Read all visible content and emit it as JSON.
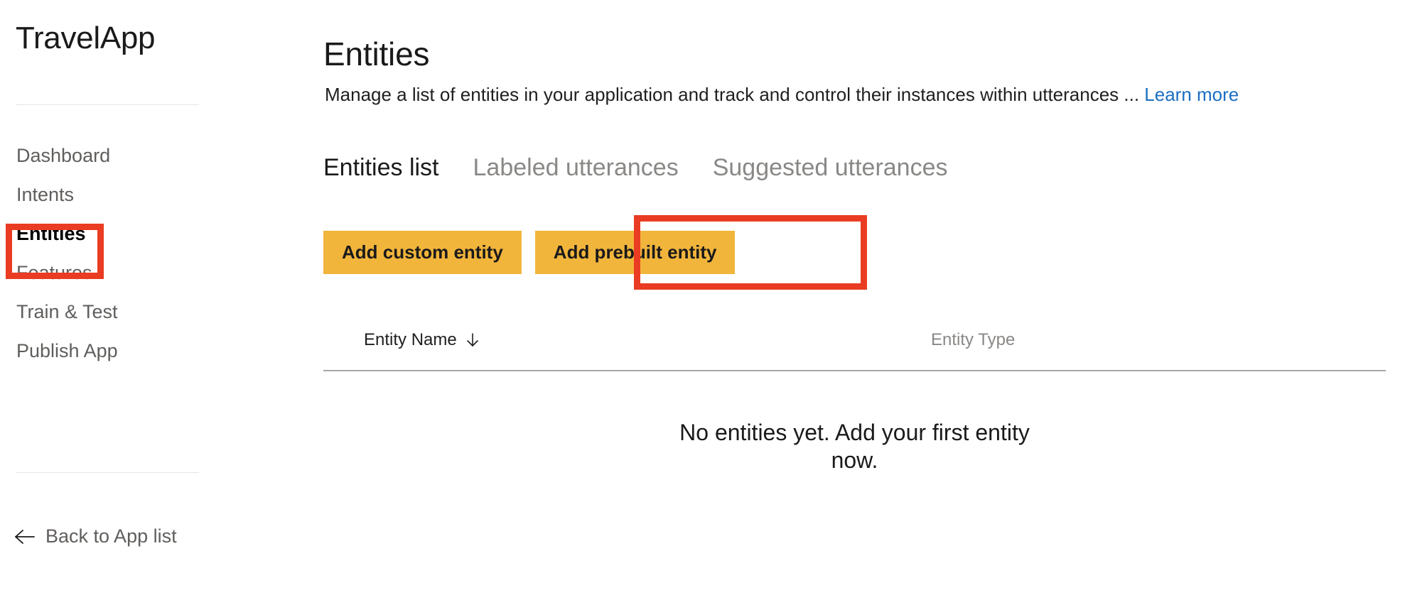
{
  "sidebar": {
    "app_title": "TravelApp",
    "items": [
      {
        "label": "Dashboard",
        "active": false
      },
      {
        "label": "Intents",
        "active": false
      },
      {
        "label": "Entities",
        "active": true
      },
      {
        "label": "Features",
        "active": false
      },
      {
        "label": "Train & Test",
        "active": false
      },
      {
        "label": "Publish App",
        "active": false
      }
    ],
    "back_link": {
      "label": "Back to App list",
      "icon": "arrow-left-icon"
    }
  },
  "main": {
    "page_title": "Entities",
    "subtitle": {
      "text": "Manage a list of entities in your application and track and control their instances within utterances ... ",
      "link_label": "Learn more"
    },
    "tabs": [
      {
        "label": "Entities list",
        "active": true
      },
      {
        "label": "Labeled utterances",
        "active": false
      },
      {
        "label": "Suggested utterances",
        "active": false
      }
    ],
    "actions": [
      {
        "label": "Add custom entity",
        "highlighted": true
      },
      {
        "label": "Add prebuilt entity",
        "highlighted": false
      }
    ],
    "table": {
      "columns": [
        {
          "label": "Entity Name",
          "sort_icon": "arrow-down-icon",
          "sorted": true
        },
        {
          "label": "Entity Type",
          "sorted": false
        }
      ],
      "rows": [],
      "empty_message_line1": "No entities yet. Add your first entity",
      "empty_message_line2": "now."
    }
  },
  "annotations": {
    "highlight_color": "#ea3c22",
    "targets": [
      "sidebar-item-entities",
      "add-custom-entity-button"
    ]
  },
  "colors": {
    "accent_button": "#f2b53c",
    "link": "#1b6ec2",
    "muted_text": "#8a8886",
    "primary_text": "#1a1a1a",
    "annotation_red": "#ea3c22"
  }
}
